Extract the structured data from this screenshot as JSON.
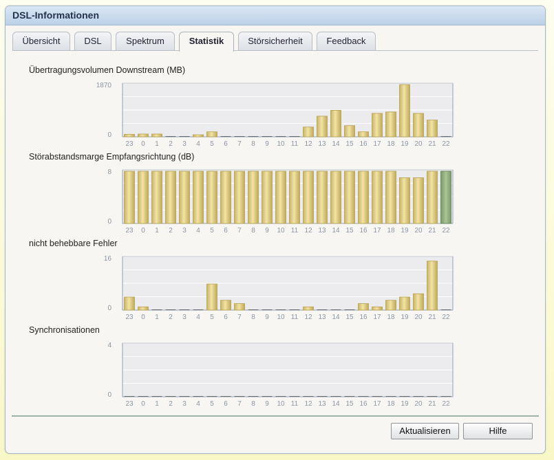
{
  "window": {
    "title": "DSL-Informationen"
  },
  "tabs": [
    {
      "label": "Übersicht",
      "active": false
    },
    {
      "label": "DSL",
      "active": false
    },
    {
      "label": "Spektrum",
      "active": false
    },
    {
      "label": "Statistik",
      "active": true
    },
    {
      "label": "Störsicherheit",
      "active": false
    },
    {
      "label": "Feedback",
      "active": false
    }
  ],
  "buttons": {
    "refresh": "Aktualisieren",
    "help": "Hilfe"
  },
  "colors": {
    "bar_gold": "#e8d591",
    "bar_gold_dark": "#b6a04e",
    "bar_green": "#8aa876",
    "grid_bg": "#ececee",
    "axis_label": "#8a95a6"
  },
  "chart_data": [
    {
      "type": "bar",
      "title": "Übertragungsvolumen Downstream (MB)",
      "categories": [
        "23",
        "0",
        "1",
        "2",
        "3",
        "4",
        "5",
        "6",
        "7",
        "8",
        "9",
        "10",
        "11",
        "12",
        "13",
        "14",
        "15",
        "16",
        "17",
        "18",
        "19",
        "20",
        "21",
        "22"
      ],
      "values": [
        90,
        100,
        100,
        0,
        0,
        20,
        180,
        0,
        0,
        0,
        0,
        0,
        0,
        350,
        740,
        950,
        400,
        180,
        840,
        890,
        1870,
        840,
        600,
        0
      ],
      "ylim": [
        0,
        1870
      ],
      "yticks": [
        "0",
        "1870"
      ],
      "highlight_index": null
    },
    {
      "type": "bar",
      "title": "Störabstandsmarge Empfangsrichtung (dB)",
      "categories": [
        "23",
        "0",
        "1",
        "2",
        "3",
        "4",
        "5",
        "6",
        "7",
        "8",
        "9",
        "10",
        "11",
        "12",
        "13",
        "14",
        "15",
        "16",
        "17",
        "18",
        "19",
        "20",
        "21",
        "22"
      ],
      "values": [
        8,
        8,
        8,
        8,
        8,
        8,
        8,
        8,
        8,
        8,
        8,
        8,
        8,
        8,
        8,
        8,
        8,
        8,
        8,
        8,
        7,
        7,
        8,
        8
      ],
      "ylim": [
        0,
        8
      ],
      "yticks": [
        "0",
        "8"
      ],
      "highlight_index": 23
    },
    {
      "type": "bar",
      "title": "nicht behebbare Fehler",
      "categories": [
        "23",
        "0",
        "1",
        "2",
        "3",
        "4",
        "5",
        "6",
        "7",
        "8",
        "9",
        "10",
        "11",
        "12",
        "13",
        "14",
        "15",
        "16",
        "17",
        "18",
        "19",
        "20",
        "21",
        "22"
      ],
      "values": [
        4,
        1,
        0,
        0,
        0,
        0,
        8,
        3,
        2,
        0,
        0,
        0,
        0,
        1,
        0,
        0,
        0,
        2,
        1,
        3,
        4,
        5,
        15,
        0
      ],
      "ylim": [
        0,
        16
      ],
      "yticks": [
        "0",
        "16"
      ],
      "highlight_index": null
    },
    {
      "type": "bar",
      "title": "Synchronisationen",
      "categories": [
        "23",
        "0",
        "1",
        "2",
        "3",
        "4",
        "5",
        "6",
        "7",
        "8",
        "9",
        "10",
        "11",
        "12",
        "13",
        "14",
        "15",
        "16",
        "17",
        "18",
        "19",
        "20",
        "21",
        "22"
      ],
      "values": [
        0,
        0,
        0,
        0,
        0,
        0,
        0,
        0,
        0,
        0,
        0,
        0,
        0,
        0,
        0,
        0,
        0,
        0,
        0,
        0,
        0,
        0,
        0,
        0
      ],
      "ylim": [
        0,
        4
      ],
      "yticks": [
        "0",
        "4"
      ],
      "highlight_index": null
    }
  ]
}
